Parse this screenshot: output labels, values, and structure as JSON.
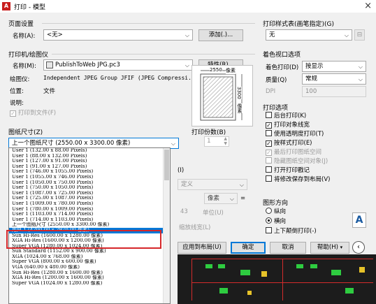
{
  "window": {
    "title": "打印 - 模型",
    "close": "×"
  },
  "page_setup": {
    "group": "页面设置",
    "name_label": "名称(A):",
    "name_value": "<无>",
    "add_button": "添加(.)..."
  },
  "printer": {
    "group": "打印机/绘图仪",
    "name_label": "名称(M):",
    "name_value": "PublishToWeb JPG.pc3",
    "properties_button": "特性(R)...",
    "plotter_label": "绘图仪:",
    "plotter_value": "Independent JPEG Group JFIF (JPEG Compressi...",
    "location_label": "位置:",
    "location_value": "文件",
    "description_label": "说明:",
    "print_to_file": "打印到文件(F)"
  },
  "preview": {
    "width_dim": "2550",
    "height_dim": "3300",
    "unit": "像素"
  },
  "paper_size": {
    "group": "图纸尺寸(Z)",
    "selected": "上一个图纸尺寸  (2550.00 x 3300.00 像素)"
  },
  "copies": {
    "label": "打印份数(B)",
    "value": "1"
  },
  "dropdown_items": [
    "User 1 (132.00 x 88.00 Pixels)",
    "User 1 (88.00 x 132.00 Pixels)",
    "User 1 (127.00 x 91.00 Pixels)",
    "User 1 (91.00 x 127.00 Pixels)",
    "User 1 (746.00 x 1055.00 Pixels)",
    "User 1 (1055.00 x 746.00 Pixels)",
    "User 1 (1050.00 x 750.00 Pixels)",
    "User 1 (750.00 x 1050.00 Pixels)",
    "User 1 (1087.00 x 725.00 Pixels)",
    "User 1 (725.00 x 1087.00 Pixels)",
    "User 1 (1009.00 x 780.00 Pixels)",
    "User 1 (780.00 x 1009.00 Pixels)",
    "User 1 (1103.00 x 714.00 Pixels)",
    "User 1 (714.00 x 1103.00 Pixels)",
    "上一个图纸尺寸  (2550.00 x 3300.00 像素)",
    "用户 1 (4200.00 x 2970.00 像素)",
    "Sun Hi-Res (1600.00 x 1280.00 像素)",
    "XGA Hi-Res (1600.00 x 1200.00 像素)",
    "Super VGA (1280.00 x 1024.00 像素)",
    "Sun Standard (1152.00 x 900.00 像素)",
    "XGA (1024.00 x 768.00 像素)",
    "Super VGA (800.00 x 600.00 像素)",
    "VGA (640.00 x 480.00 像素)",
    "Sun Hi-Res (1280.00 x 1600.00 像素)",
    "XGA Hi-Res (1200.00 x 1600.00 像素)",
    "Super VGA (1024.00 x 1280.00 像素)"
  ],
  "hidden_area": {
    "frag1": "(I)",
    "combo_disabled": "定义",
    "pixels": "像素",
    "equals": "=",
    "number": "43",
    "unit": "单位(U)",
    "lineweight": "缩放线宽(L)"
  },
  "plot_style": {
    "group": "打印样式表(画笔指定)(G)",
    "value": "无"
  },
  "shaded": {
    "group": "着色视口选项",
    "shade_label": "着色打印(D)",
    "shade_value": "按显示",
    "quality_label": "质量(Q)",
    "quality_value": "常规",
    "dpi_label": "DPI",
    "dpi_value": "100"
  },
  "options": {
    "group": "打印选项",
    "items": [
      {
        "label": "后台打印(K)",
        "checked": false,
        "enabled": true
      },
      {
        "label": "打印对象线宽",
        "checked": true,
        "enabled": true
      },
      {
        "label": "使用透明度打印(T)",
        "checked": false,
        "enabled": true
      },
      {
        "label": "按样式打印(E)",
        "checked": true,
        "enabled": true
      },
      {
        "label": "最后打印图纸空间",
        "checked": true,
        "enabled": false
      },
      {
        "label": "隐藏图纸空间对象(J)",
        "checked": false,
        "enabled": false
      },
      {
        "label": "打开打印戳记",
        "checked": false,
        "enabled": true
      },
      {
        "label": "将修改保存到布局(V)",
        "checked": false,
        "enabled": true
      }
    ]
  },
  "orientation": {
    "group": "图形方向",
    "portrait": "纵向",
    "landscape": "横向",
    "upside_down": "上下颠倒打印(-)"
  },
  "buttons": {
    "apply": "应用到布局(U)",
    "ok": "确定",
    "cancel": "取消",
    "help": "帮助(H)"
  }
}
